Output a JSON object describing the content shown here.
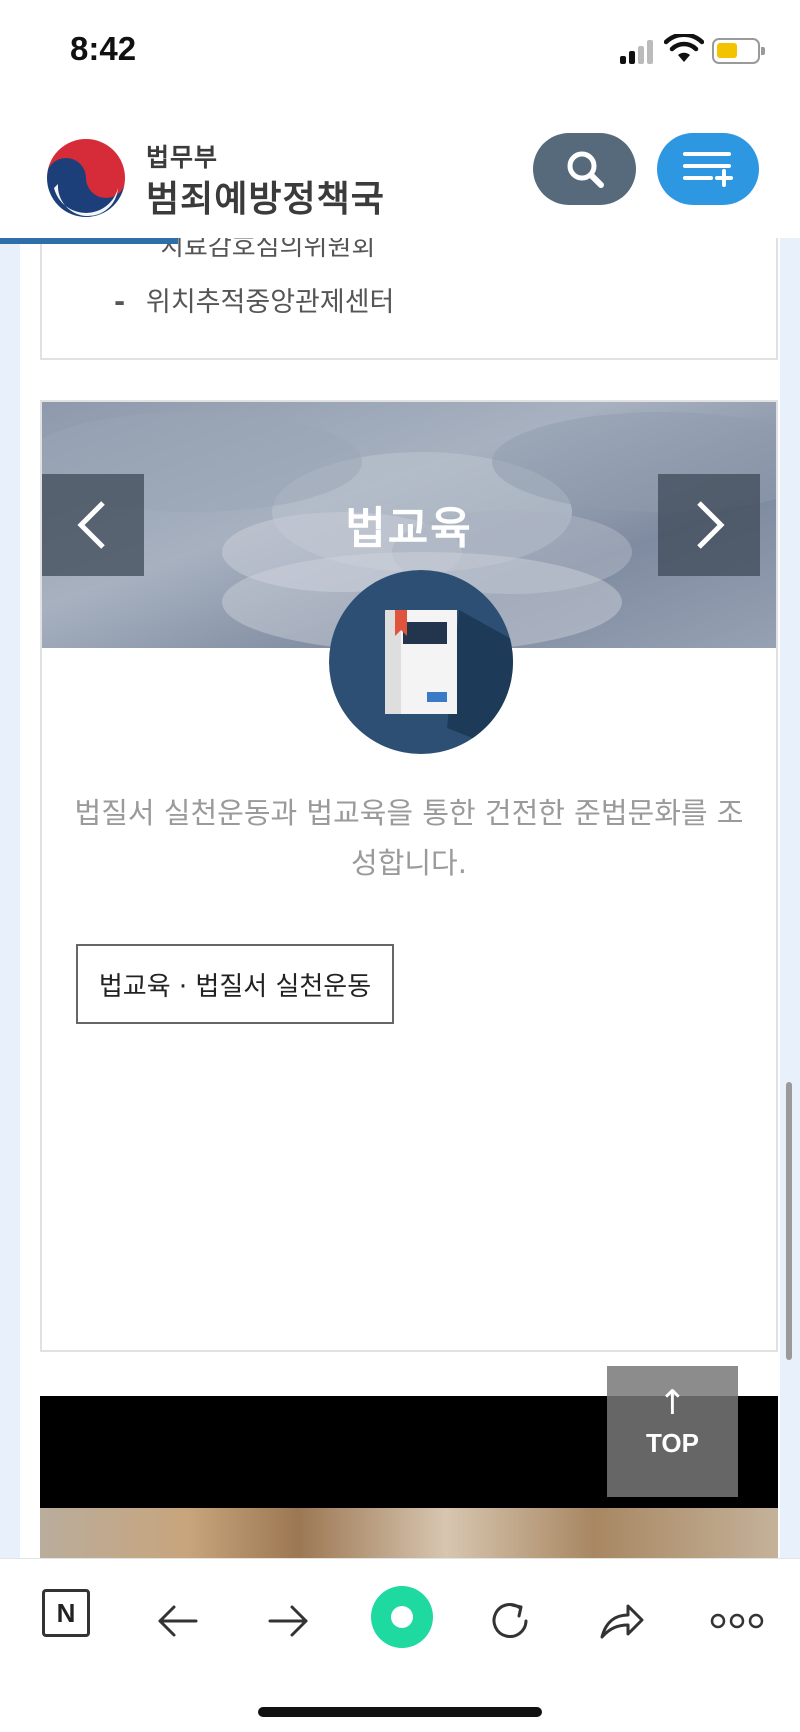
{
  "status": {
    "time": "8:42"
  },
  "header": {
    "ministry": "법무부",
    "department": "범죄예방정책국",
    "search_icon": "search-icon",
    "menu_icon": "menu-plus-icon"
  },
  "list": {
    "cut_item": "치료감호심의위원회",
    "item": "위치추적중앙관제센터"
  },
  "card": {
    "title": "법교육",
    "description": "법질서 실천운동과 법교육을 통한 건전한 준법문화를 조성합니다.",
    "link_label": "법교육 · 법질서 실천운동",
    "prev_icon": "chevron-left-icon",
    "next_icon": "chevron-right-icon",
    "icon": "book-icon"
  },
  "top_button": {
    "arrow": "↑",
    "label": "TOP"
  },
  "toolbar": {
    "naver_label": "N",
    "icons": [
      "back-arrow-icon",
      "forward-arrow-icon",
      "home-dot-icon",
      "refresh-icon",
      "share-icon",
      "more-icon"
    ]
  },
  "colors": {
    "accent_blue": "#2d97e2",
    "search_gray": "#566a7c",
    "progress": "#2f6fa7",
    "home_green": "#1ed9a0"
  }
}
